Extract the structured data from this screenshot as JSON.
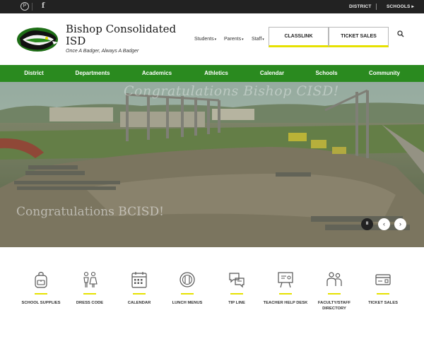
{
  "topbar": {
    "social": [
      {
        "icon": "pinterest-icon"
      },
      {
        "icon": "facebook-icon"
      }
    ],
    "links": [
      {
        "label": "DISTRICT"
      },
      {
        "label": "SCHOOLS ▸"
      }
    ]
  },
  "header": {
    "title": "Bishop Consolidated ISD",
    "tagline": "Once A Badger, Always A Badger",
    "nav": [
      {
        "label": "Students"
      },
      {
        "label": "Parents"
      },
      {
        "label": "Staff"
      }
    ],
    "buttons": [
      {
        "label": "CLASSLINK"
      },
      {
        "label": "TICKET SALES"
      }
    ],
    "accent": "#e6e100"
  },
  "mainnav": {
    "color": "#2a8a1f",
    "items": [
      {
        "label": "District"
      },
      {
        "label": "Departments"
      },
      {
        "label": "Academics"
      },
      {
        "label": "Athletics"
      },
      {
        "label": "Calendar"
      },
      {
        "label": "Schools"
      },
      {
        "label": "Community"
      }
    ]
  },
  "hero": {
    "overlay_title": "Congratulations Bishop CISD!",
    "caption": "Congratulations BCISD!",
    "controls": {
      "pause": "II",
      "prev": "‹",
      "next": "›"
    }
  },
  "quicklinks": [
    {
      "label": "SCHOOL SUPPLIES",
      "icon": "backpack-icon"
    },
    {
      "label": "DRESS CODE",
      "icon": "dress-code-icon"
    },
    {
      "label": "CALENDAR",
      "icon": "calendar-icon"
    },
    {
      "label": "LUNCH MENUS",
      "icon": "lunch-icon"
    },
    {
      "label": "TIP LINE",
      "icon": "chat-bubbles-icon"
    },
    {
      "label": "TEACHER HELP DESK",
      "icon": "presentation-icon"
    },
    {
      "label": "FACULTY/STAFF DIRECTORY",
      "icon": "people-icon"
    },
    {
      "label": "TICKET SALES",
      "icon": "ticket-icon"
    }
  ]
}
